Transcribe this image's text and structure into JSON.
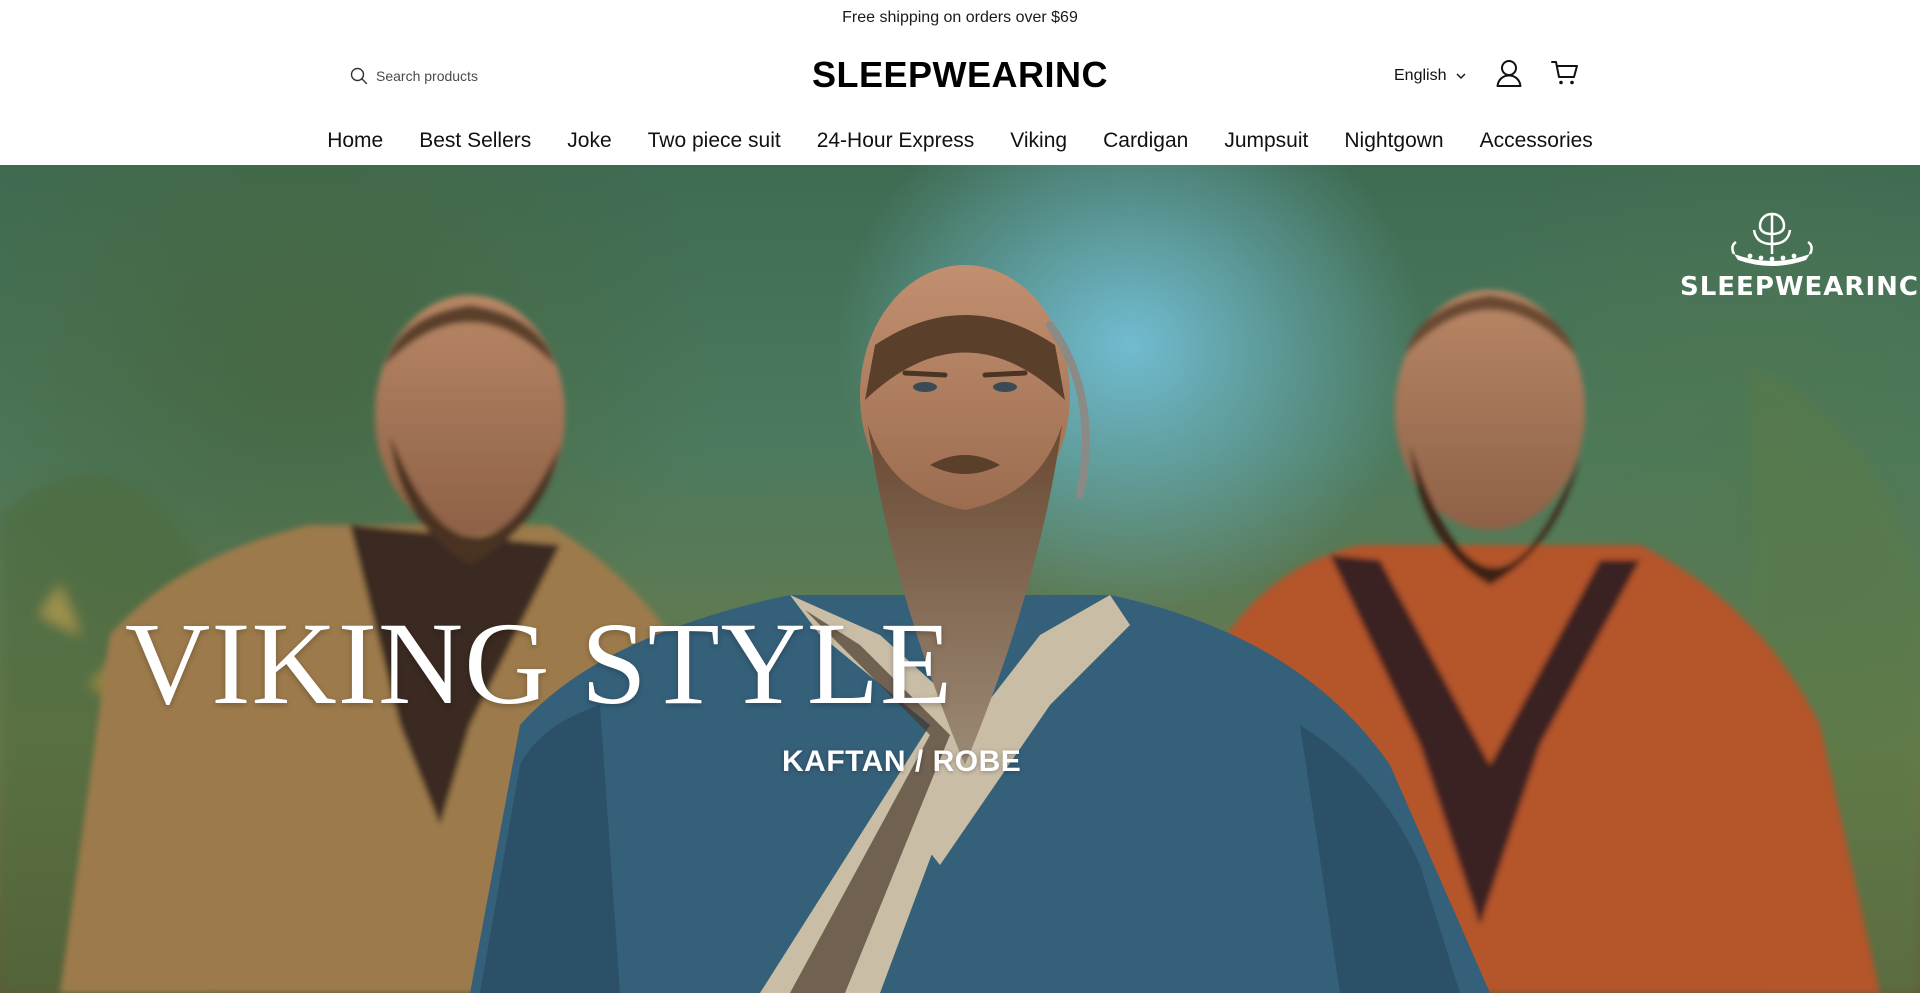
{
  "announcement": {
    "text": "Free shipping on orders over $69"
  },
  "header": {
    "search": {
      "placeholder": "Search products",
      "icon": "search-icon"
    },
    "logo": "SLEEPWEARINC",
    "language": {
      "selected": "English",
      "icon": "chevron-down-icon"
    },
    "account_icon": "user-icon",
    "cart_icon": "cart-icon"
  },
  "nav": {
    "items": [
      {
        "label": "Home"
      },
      {
        "label": "Best Sellers"
      },
      {
        "label": "Joke"
      },
      {
        "label": "Two piece suit"
      },
      {
        "label": "24-Hour Express"
      },
      {
        "label": "Viking"
      },
      {
        "label": "Cardigan"
      },
      {
        "label": "Jumpsuit"
      },
      {
        "label": "Nightgown"
      },
      {
        "label": "Accessories"
      }
    ]
  },
  "hero": {
    "title": "VIKING STYLE",
    "subtitle": "KAFTAN / ROBE",
    "brand_watermark": "SLEEPWEARINC",
    "image": "three-bearded-men-in-viking-robes",
    "colors": {
      "left_robe": "#9c7a4c",
      "center_robe": "#35607a",
      "right_robe": "#b4552c",
      "sky_highlight": "#7cc6e0"
    }
  }
}
